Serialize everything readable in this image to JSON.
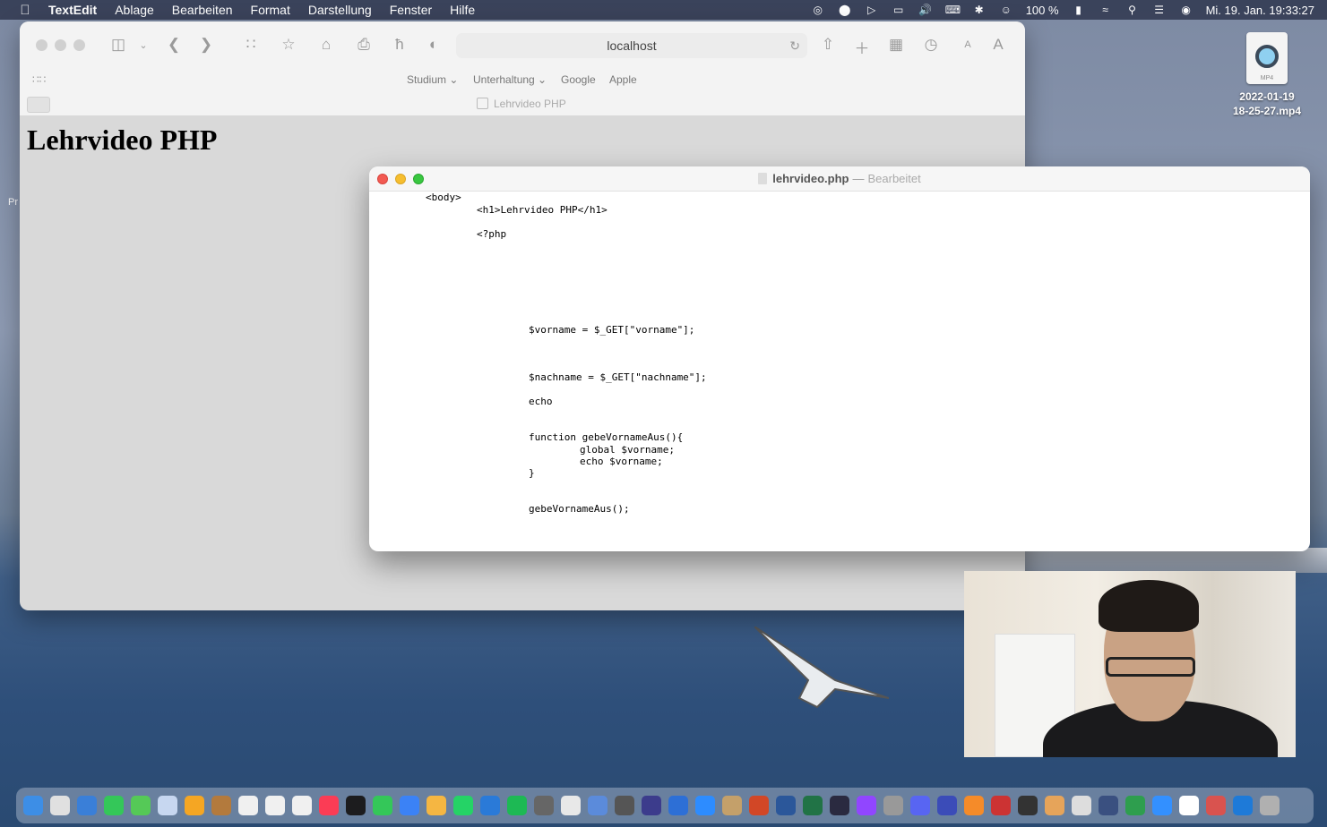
{
  "menubar": {
    "app_name": "TextEdit",
    "menus": [
      "Ablage",
      "Bearbeiten",
      "Format",
      "Darstellung",
      "Fenster",
      "Hilfe"
    ],
    "battery": "100 %",
    "clock": "Mi. 19. Jan.  19:33:27",
    "status_icons": [
      "creative-cloud-icon",
      "b-app-icon",
      "play-icon",
      "display-icon",
      "volume-icon",
      "keyboard-icon",
      "bluetooth-icon",
      "user-icon",
      "battery-icon",
      "wifi-icon",
      "search-icon",
      "control-center-icon",
      "siri-icon"
    ]
  },
  "desktop": {
    "file_icon_ext": "MP4",
    "file_name_line1": "2022-01-19",
    "file_name_line2": "18-25-27.mp4",
    "stray_text": "Pr"
  },
  "safari": {
    "url": "localhost",
    "favorites": [
      "Studium ⌄",
      "Unterhaltung ⌄",
      "Google",
      "Apple"
    ],
    "tab_title": "Lehrvideo PHP",
    "page_heading": "Lehrvideo PHP"
  },
  "textedit": {
    "file_name": "lehrvideo.php",
    "separator": "—",
    "state": "Bearbeitet",
    "code_lines": [
      "<body>",
      "<h1>Lehrvideo PHP</h1>",
      "<?php",
      "$vorname = $_GET[\"vorname\"];",
      "$nachname = $_GET[\"nachname\"];",
      "echo",
      "function gebeVornameAus(){",
      "global $vorname;",
      "echo $vorname;",
      "}",
      "gebeVornameAus();"
    ]
  },
  "dock": {
    "item_colors": [
      "#3d8ee6",
      "#e0e0e0",
      "#3a7fd8",
      "#34c759",
      "#55c957",
      "#c7d7f0",
      "#f5a623",
      "#b37a3d",
      "#f0f0f0",
      "#f0f0f0",
      "#f0f0f0",
      "#fb3c55",
      "#1c1c1e",
      "#34c759",
      "#3b82f6",
      "#f5b642",
      "#25d366",
      "#2a7ad8",
      "#1db954",
      "#666666",
      "#e8e8e8",
      "#5b8bdb",
      "#555555",
      "#3c3c8c",
      "#2d6fd6",
      "#2d8cff",
      "#c4a06a",
      "#d24726",
      "#2b579a",
      "#217346",
      "#2a2a40",
      "#9146ff",
      "#999999",
      "#5865f2",
      "#3b4cb8",
      "#f58b29",
      "#cc3333",
      "#333333",
      "#e6a45a",
      "#dddddd",
      "#3a5080",
      "#2e9e4e",
      "#3390ff",
      "#ffffff",
      "#d9534f",
      "#1e7ad8",
      "#b0b0b0"
    ]
  }
}
